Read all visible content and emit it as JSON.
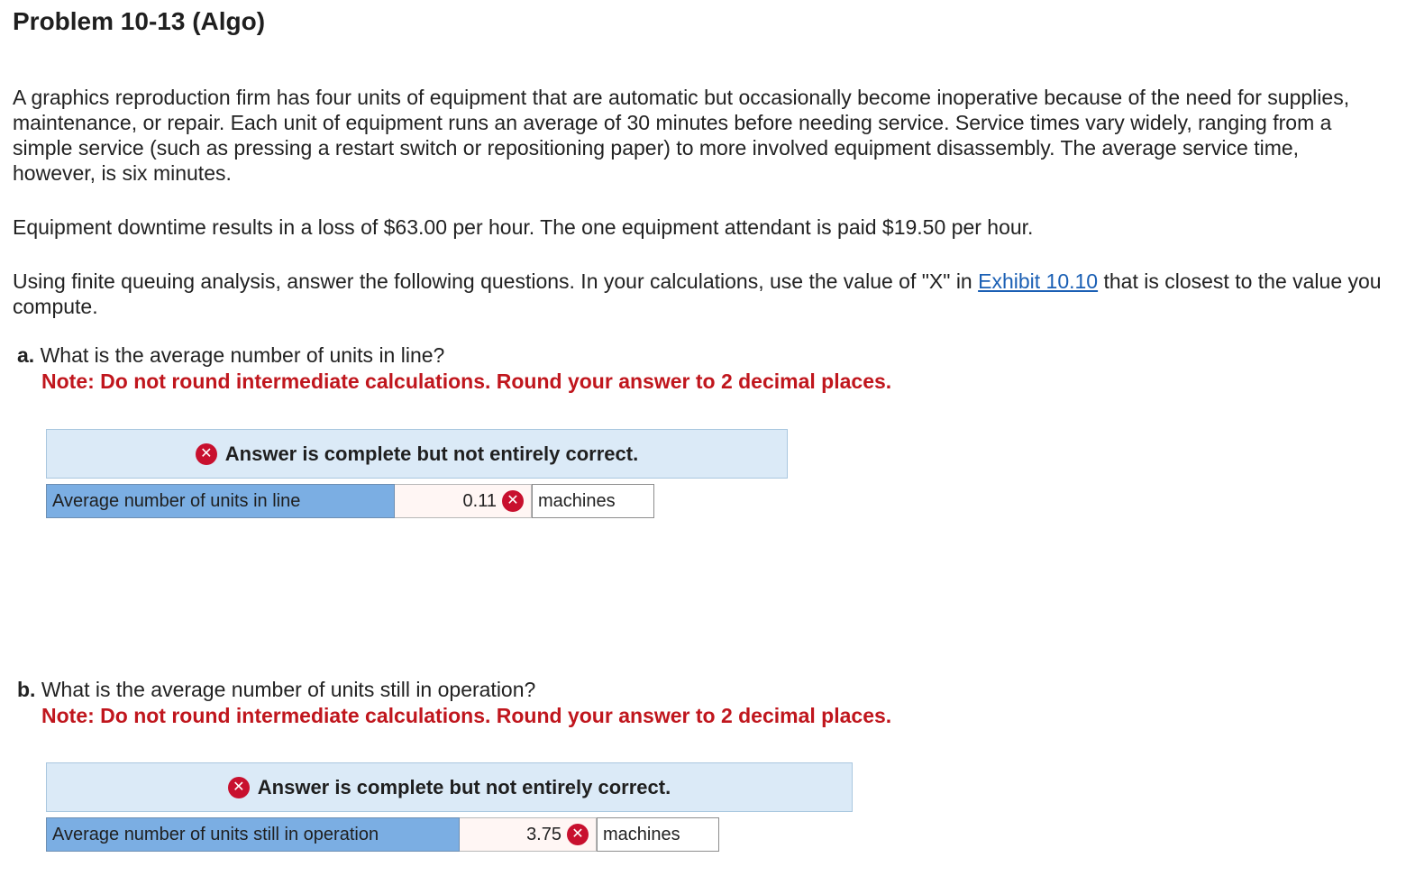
{
  "title": "Problem 10-13 (Algo)",
  "intro": "A graphics reproduction firm has four units of equipment that are automatic but occasionally become inoperative because of the need for supplies, maintenance, or repair. Each unit of equipment runs an average of 30 minutes before needing service. Service times vary widely, ranging from a simple service (such as pressing a restart switch or repositioning paper) to more involved equipment disassembly. The average service time, however, is six minutes.",
  "costs": "Equipment downtime results in a loss of $63.00 per hour. The one equipment attendant is paid $19.50 per hour.",
  "instructions": {
    "before": "Using finite queuing analysis, answer the following questions. In your calculations, use the value of \"X\" in ",
    "link": "Exhibit 10.10",
    "after": "  that is closest to the value you compute."
  },
  "parts": [
    {
      "label": "a.",
      "question": " What is the average number of units in line?",
      "note": "Note: Do not round intermediate calculations. Round your answer to 2 decimal places.",
      "banner": "Answer is complete but not entirely correct.",
      "row_label": "Average number of units in line",
      "value": "0.11",
      "unit": "machines",
      "status": "incorrect"
    },
    {
      "label": "b.",
      "question": " What is the average number of units still in operation?",
      "note": "Note: Do not round intermediate calculations. Round your answer to 2 decimal places.",
      "banner": "Answer is complete but not entirely correct.",
      "row_label": "Average number of units still in operation",
      "value": "3.75",
      "unit": "machines",
      "status": "incorrect"
    }
  ],
  "icons": {
    "incorrect": "x-circle-icon"
  },
  "colors": {
    "note_red": "#c0161d",
    "link_blue": "#1a5fb4",
    "banner_bg": "#dbeaf7",
    "label_cell_bg": "#7baee3",
    "error_icon": "#c8102e"
  }
}
